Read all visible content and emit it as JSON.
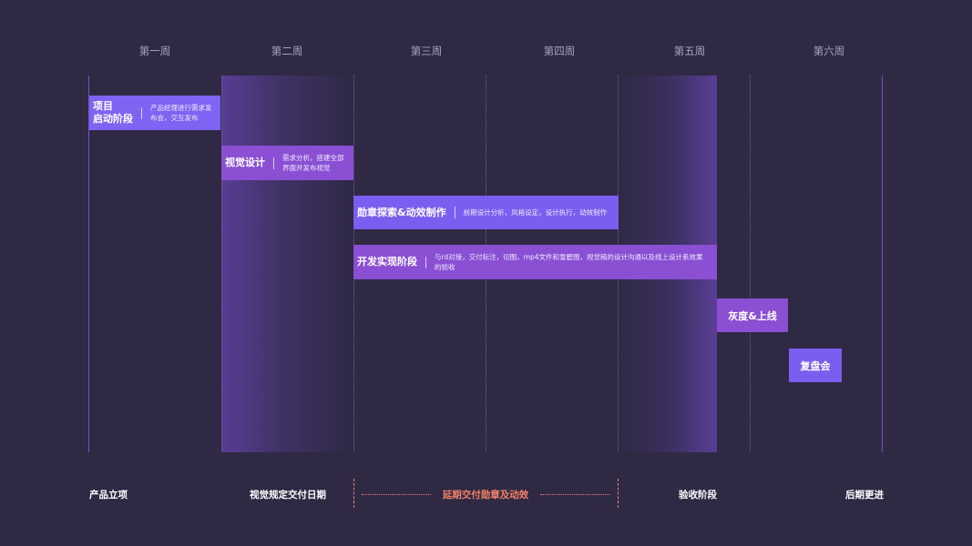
{
  "weeks": [
    "第一周",
    "第二周",
    "第三周",
    "第四周",
    "第五周",
    "第六周"
  ],
  "tasks": [
    {
      "title": "项目\n启动阶段",
      "desc": "产品经理进行需求发布会，交互发布"
    },
    {
      "title": "视觉设计",
      "desc": "需求分析，搭建全部界面并发布视觉"
    },
    {
      "title": "勋章探索&动效制作",
      "desc": "前期设计分析，风格设定，设计执行，动效制作"
    },
    {
      "title": "开发实现阶段",
      "desc": "与rd对接，交付标注，切图，mp4文件和雪碧图，视觉稿的设计沟通以及线上设计系效果的验收"
    }
  ],
  "small_tasks": [
    "灰度&上线",
    "复盘会"
  ],
  "milestones": [
    "产品立项",
    "视觉规定交付日期",
    "延期交付勋章及动效",
    "验收阶段",
    "后期更进"
  ],
  "colors": {
    "background": "#2f2944",
    "task_blue": "#7f63f2",
    "task_purple": "#8a4fd3",
    "delay": "#f5836a"
  }
}
